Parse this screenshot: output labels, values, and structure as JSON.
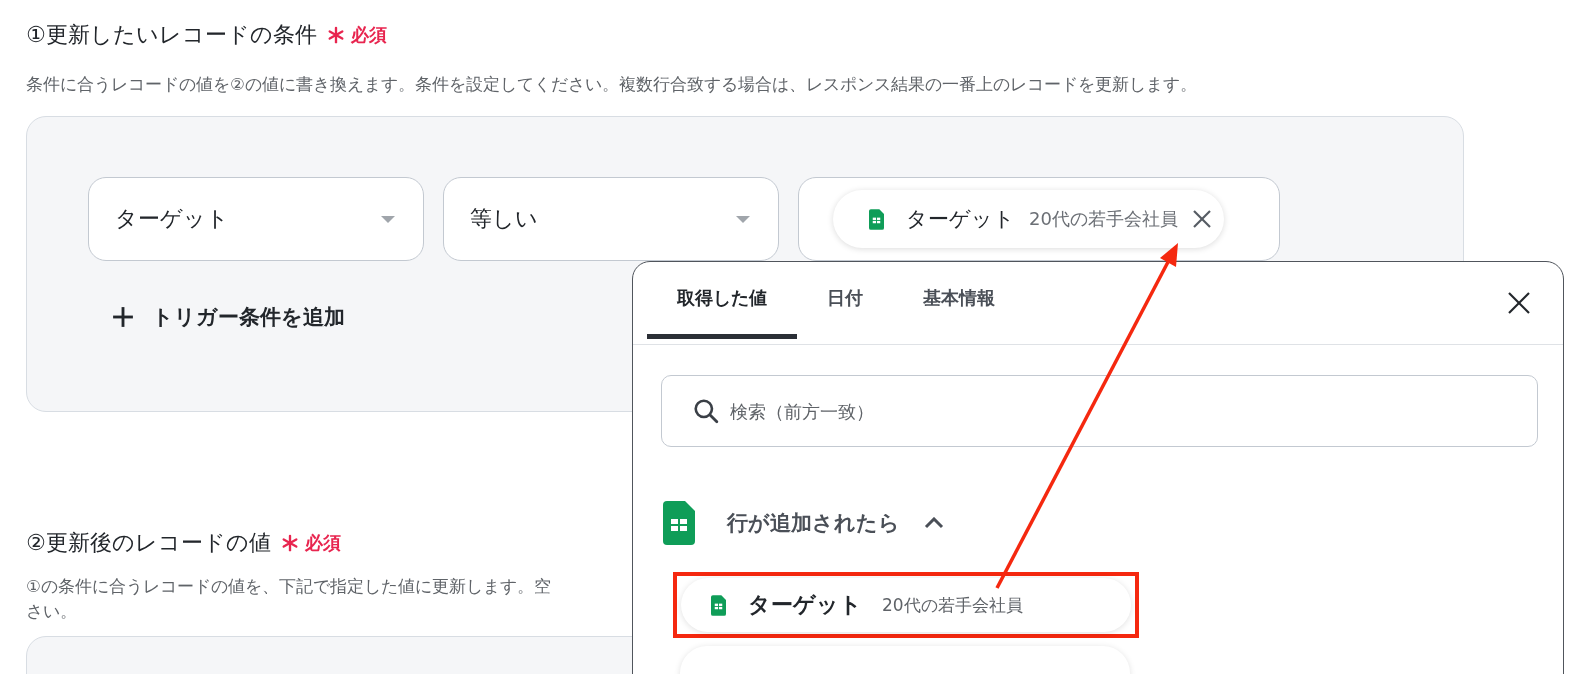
{
  "section_1": {
    "title": "①更新したいレコードの条件",
    "required_label": "必須",
    "description": "条件に合うレコードの値を②の値に書き換えます。条件を設定してください。複数行合致する場合は、レスポンス結果の一番上のレコードを更新します。",
    "conditions": [
      {
        "field": "ターゲット",
        "operator": "等しい",
        "value": {
          "label": "ターゲット",
          "value": "20代の若手会社員"
        }
      }
    ],
    "add_button": "トリガー条件を追加"
  },
  "section_2": {
    "title": "②更新後のレコードの値",
    "required_label": "必須",
    "description_lines": [
      "①の条件に合うレコードの値を、下記で指定した値に更新します。空",
      "さい。"
    ]
  },
  "popup": {
    "tabs": [
      {
        "label": "取得した値",
        "selected": true
      },
      {
        "label": "日付",
        "selected": false
      },
      {
        "label": "基本情報",
        "selected": false
      }
    ],
    "search": {
      "placeholder": "検索（前方一致）"
    },
    "groups": [
      {
        "title": "行が追加されたら",
        "expanded": true,
        "items": [
          {
            "label": "ターゲット",
            "value": "20代の若手会社員",
            "highlighted": true
          }
        ]
      }
    ]
  }
}
